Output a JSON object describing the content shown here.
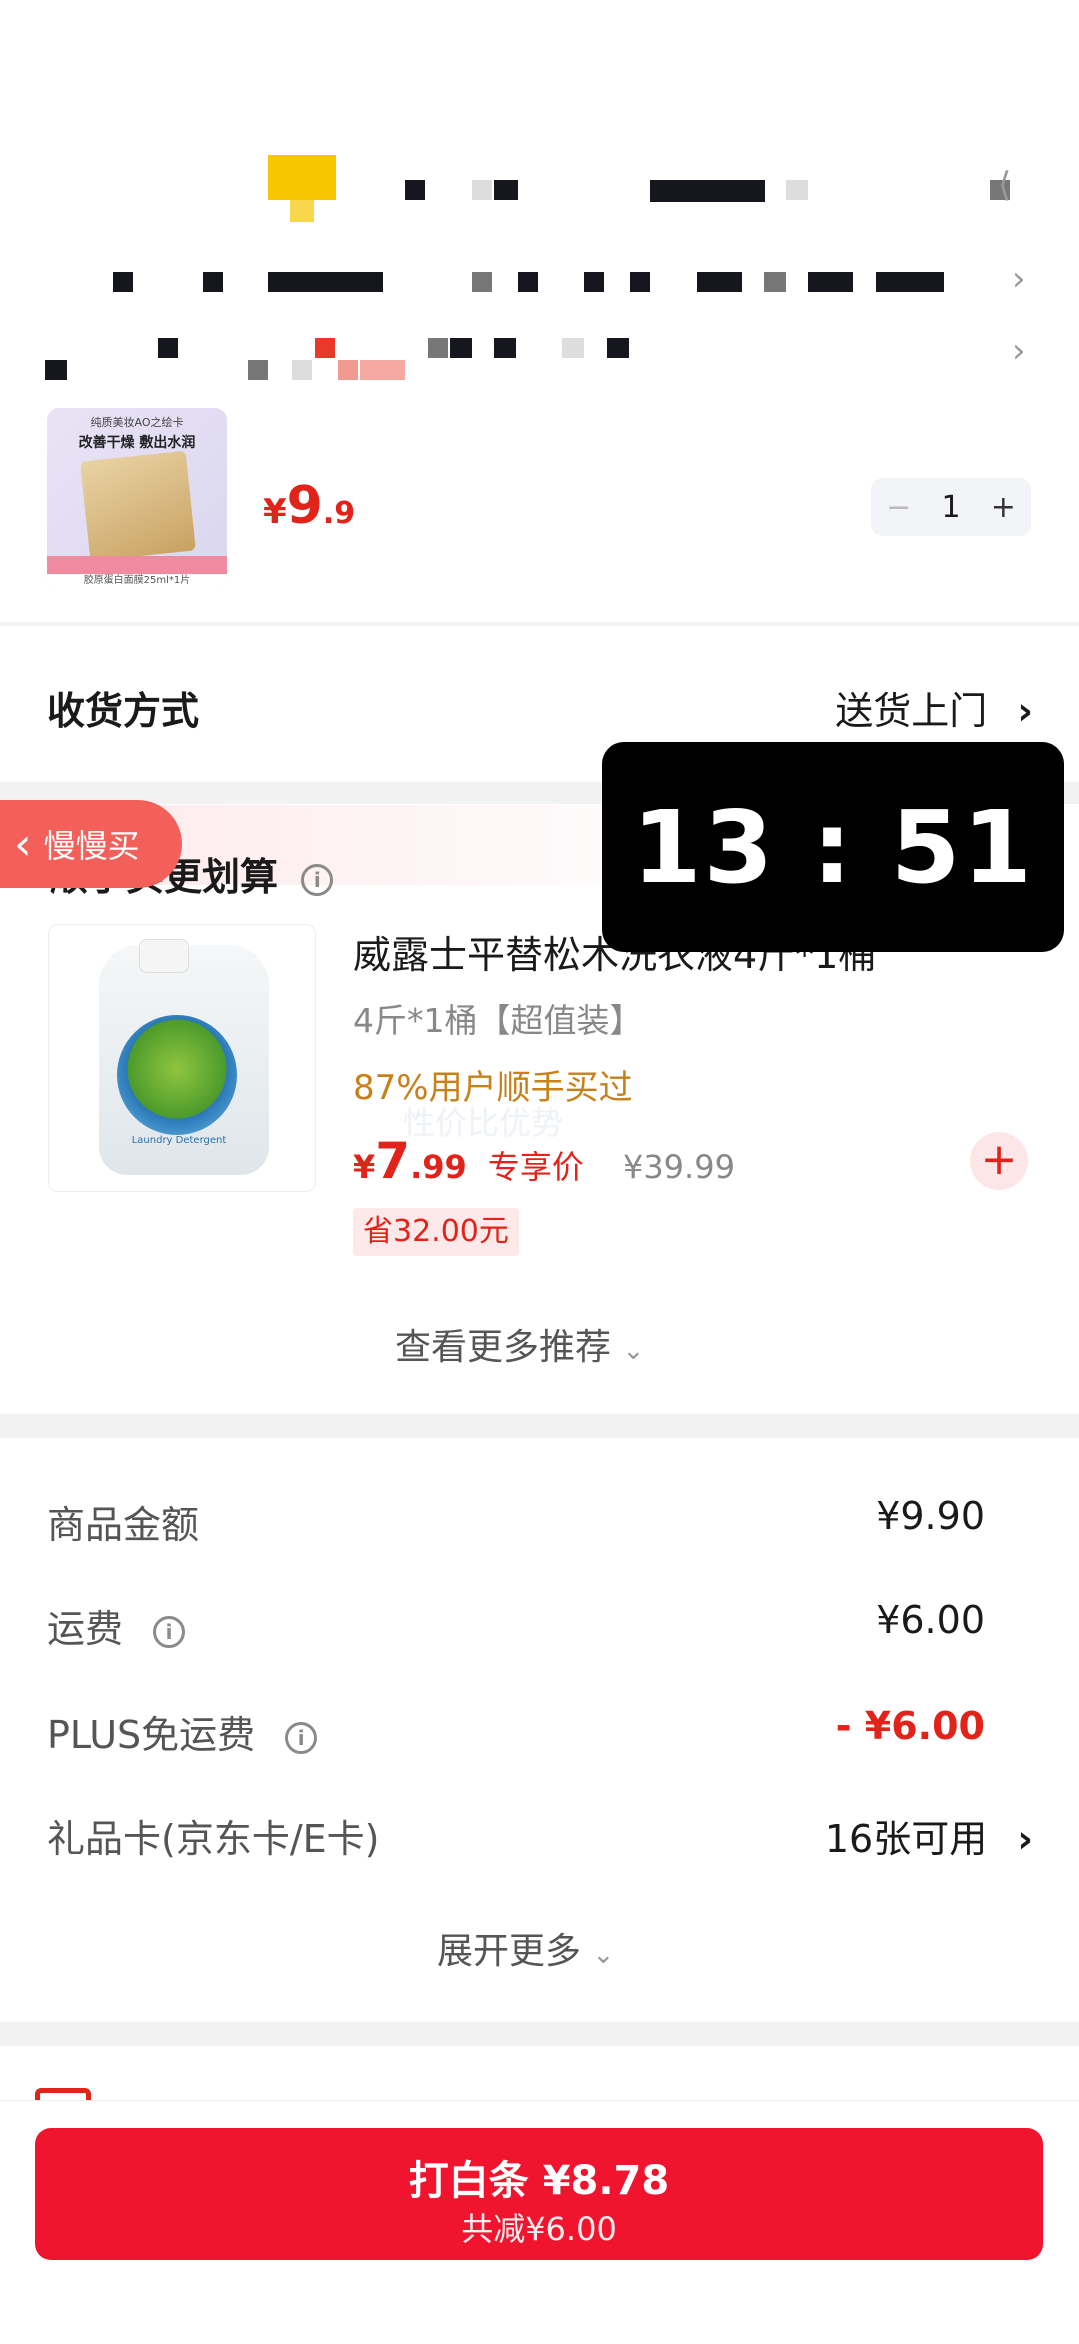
{
  "product": {
    "thumb_top_text": "纯质美妆AO之绘卡",
    "thumb_slogan": "改善干燥 敷出水润",
    "thumb_bottom_text": "胶原蛋白面膜25ml*1片",
    "price_currency": "¥",
    "price_int": "9",
    "price_dec": ".9",
    "quantity": "1",
    "minus": "−",
    "plus": "+"
  },
  "delivery": {
    "label": "收货方式",
    "value": "送货上门",
    "arrow": "›"
  },
  "timer": "13 : 51",
  "slow_buy": {
    "arrow": "‹",
    "label": "慢慢买"
  },
  "recommend": {
    "title": "顺手买更划算",
    "info": "i",
    "item_title": "威露士平替松木洗衣液4斤*1桶",
    "item_spec": "4斤*1桶【超值装】",
    "item_buyers": "87%用户顺手买过",
    "watermark": "性价比优势",
    "price_currency": "¥",
    "price_int": "7",
    "price_dec": ".99",
    "price_tag": "专享价",
    "orig_price": "¥39.99",
    "save": "省32.00元",
    "add": "+",
    "bottle_text": "Laundry Detergent",
    "more": "查看更多推荐"
  },
  "summary": {
    "rows": [
      {
        "label": "商品金额",
        "value": "¥9.90"
      },
      {
        "label": "运费",
        "value": "¥6.00"
      },
      {
        "label": "PLUS免运费",
        "value": "- ¥6.00"
      },
      {
        "label": "礼品卡(京东卡/E卡)",
        "value": "16张可用"
      }
    ],
    "gift_arrow": "›",
    "expand": "展开更多"
  },
  "pay": {
    "main": "打白条 ¥8.78",
    "sub": "共减¥6.00"
  },
  "colors": {
    "accent_red": "#e2231a",
    "pay_red": "#f0142e",
    "orange": "#c8801a"
  }
}
